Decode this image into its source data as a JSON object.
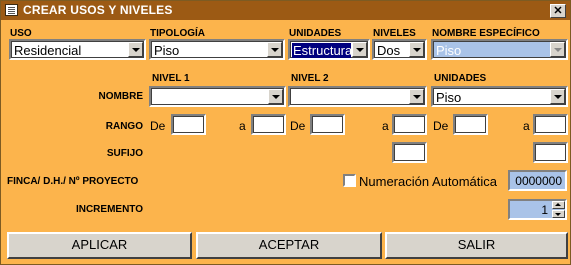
{
  "window": {
    "title": "CREAR USOS Y NIVELES",
    "close_glyph": "✕"
  },
  "header_labels": {
    "uso": "USO",
    "tipologia": "TIPOLOGÍA",
    "unidades": "UNIDADES",
    "niveles": "NIVELES",
    "nombre_especifico": "NOMBRE ESPECÍFICO"
  },
  "selects": {
    "uso": "Residencial",
    "tipologia": "Piso",
    "unidades": "Estructura",
    "niveles": "Dos",
    "nombre_especifico": "Piso",
    "nivel1": "",
    "nivel2": "",
    "unidades_nombre": "Piso"
  },
  "sub_headers": {
    "nivel1": "NIVEL 1",
    "nivel2": "NIVEL 2",
    "unidades": "UNIDADES"
  },
  "rows": {
    "nombre": "NOMBRE",
    "rango": "RANGO",
    "sufijo": "SUFIJO",
    "finca": "FINCA/ D.H./ Nº PROYECTO",
    "incremento": "INCREMENTO"
  },
  "range_words": {
    "de": "De",
    "a": "a"
  },
  "numeracion_label": "Numeración Automática",
  "numeracion_value": "0000000",
  "incremento_value": "1",
  "buttons": {
    "aplicar": "APLICAR",
    "aceptar": "ACEPTAR",
    "salir": "SALIR"
  }
}
